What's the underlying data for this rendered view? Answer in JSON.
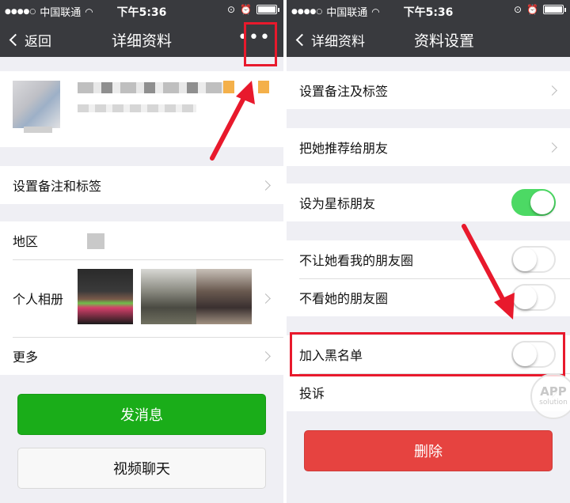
{
  "status_bar": {
    "signal_dots": "●●●●○",
    "carrier": "中国联通",
    "time": "下午5:36"
  },
  "left": {
    "nav": {
      "back_label": "返回",
      "title": "详细资料",
      "more_label": "•••"
    },
    "rows": {
      "remark_tags": "设置备注和标签",
      "region": "地区",
      "album": "个人相册",
      "more": "更多"
    },
    "buttons": {
      "send_message": "发消息",
      "video_call": "视频聊天"
    }
  },
  "right": {
    "nav": {
      "back_label": "详细资料",
      "title": "资料设置"
    },
    "rows": {
      "remark_tags": "设置备注及标签",
      "recommend": "把她推荐给朋友",
      "star_friend": "设为星标朋友",
      "hide_my_moments": "不让她看我的朋友圈",
      "hide_her_moments": "不看她的朋友圈",
      "blacklist": "加入黑名单",
      "report": "投诉"
    },
    "toggles": {
      "star_friend": true,
      "hide_my_moments": false,
      "hide_her_moments": false,
      "blacklist": false
    },
    "buttons": {
      "delete": "删除"
    }
  },
  "watermark": {
    "text1": "APP",
    "text2": "solution"
  },
  "colors": {
    "nav_bg": "#393a3e",
    "green": "#1aad19",
    "toggle_on": "#4cd964",
    "delete_red": "#e64340",
    "highlight_red": "#e8192c"
  }
}
